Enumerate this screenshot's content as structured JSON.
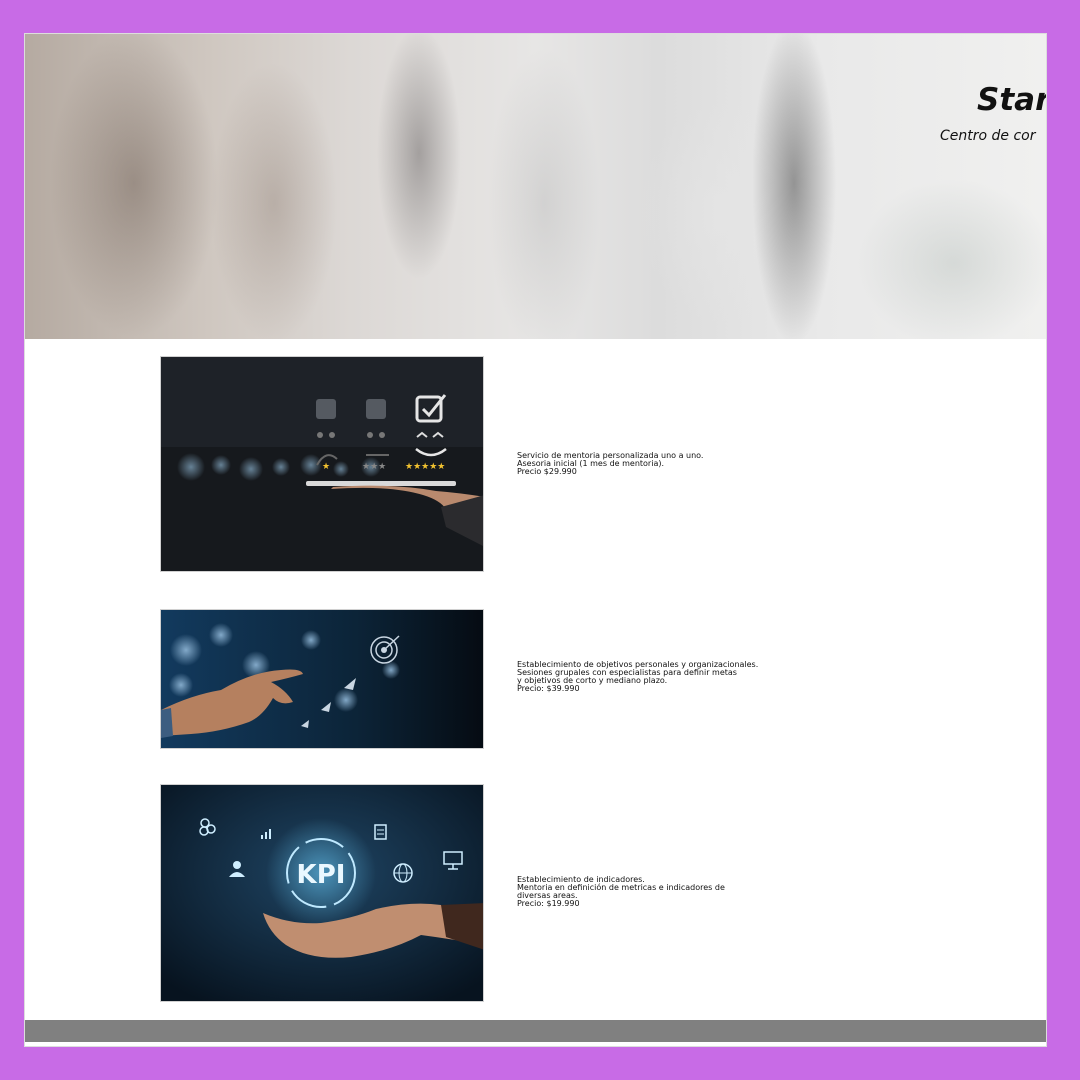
{
  "header": {
    "title": "Star",
    "subtitle": "Centro de cor"
  },
  "services": [
    {
      "image_icon": "customer-rating-icon",
      "lines": [
        "Servicio de mentoria personalizada uno a uno.",
        "Asesoria inicial (1 mes de mentoria).",
        "Precio $29.990"
      ]
    },
    {
      "image_icon": "target-goals-icon",
      "lines": [
        "Establecimiento de objetivos personales y organizacionales.",
        "Sesiones grupales con especialistas para definir metas",
        "y objetivos de corto y mediano plazo.",
        "Precio: $39.990"
      ]
    },
    {
      "image_icon": "kpi-icon",
      "kpi_label": "KPI",
      "lines": [
        "Establecimiento de indicadores.",
        "Mentoria en definición de metricas e indicadores de",
        "diversas areas.",
        "Precio: $19.990"
      ]
    }
  ],
  "colors": {
    "frame": "#c86be6",
    "footer": "#808080",
    "accent_star": "#f2c230"
  }
}
